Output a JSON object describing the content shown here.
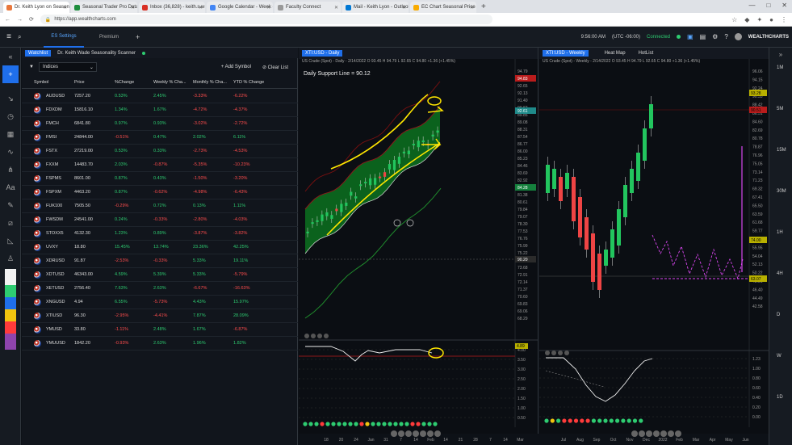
{
  "browser": {
    "tabs": [
      {
        "label": "Dr. Keith Lyon on Seasonal - Wea",
        "color": "#e8773d",
        "active": true
      },
      {
        "label": "Seasonal Trader Pro Database",
        "color": "#1e8e3e"
      },
      {
        "label": "Inbox (36,828) - keith.s.w@ib...",
        "color": "#d93025"
      },
      {
        "label": "Google Calendar - Week of 14...",
        "color": "#4285f4"
      },
      {
        "label": "Faculty Connect",
        "color": "#999999"
      },
      {
        "label": "Mail - Keith Lyon - Outlook",
        "color": "#0078d4"
      },
      {
        "label": "EC Chart Seasonal Price Tools",
        "color": "#f9ab00"
      }
    ],
    "url": "https://app.wealthcharts.com",
    "window_controls": [
      "—",
      "□",
      "✕"
    ]
  },
  "app": {
    "tabs": [
      "ES Settings",
      "Premium"
    ],
    "time": "9:56:00 AM",
    "tz": "(UTC -06:00)",
    "status": "Connected",
    "brand": "WEALTHCHARTS"
  },
  "watchlist": {
    "title": "Watchlist",
    "scanner": "Dr. Keith Wade Seasonality Scanner",
    "filter": "Indices",
    "add_label": "Add Symbol",
    "clear_label": "Clear List",
    "columns": [
      "Symbol",
      "Price",
      "%Change",
      "Weekly % Cha...",
      "Monthly % Cha...",
      "YTD % Change"
    ],
    "rows": [
      {
        "s": "AUDUSD",
        "p": "7257.20",
        "c": "0.53%",
        "w": "2.45%",
        "m": "-3.33%",
        "y": "-6.22%"
      },
      {
        "s": "FDXDM",
        "p": "15816.10",
        "c": "1.34%",
        "w": "1.67%",
        "m": "-4.72%",
        "y": "-4.37%"
      },
      {
        "s": "FMCH",
        "p": "6841.80",
        "c": "0.97%",
        "w": "0.93%",
        "m": "-3.02%",
        "y": "-2.72%"
      },
      {
        "s": "FMSI",
        "p": "24844.00",
        "c": "-0.51%",
        "w": "0.47%",
        "m": "2.02%",
        "y": "6.11%"
      },
      {
        "s": "FSTX",
        "p": "27219.00",
        "c": "0.53%",
        "w": "0.33%",
        "m": "-2.73%",
        "y": "-4.53%"
      },
      {
        "s": "FXXM",
        "p": "14483.70",
        "c": "2.03%",
        "w": "-0.87%",
        "m": "-5.35%",
        "y": "-10.23%"
      },
      {
        "s": "FSPMS",
        "p": "8601.00",
        "c": "0.87%",
        "w": "0.43%",
        "m": "-1.50%",
        "y": "-3.20%"
      },
      {
        "s": "FSPXM",
        "p": "4463.20",
        "c": "0.87%",
        "w": "-0.62%",
        "m": "-4.98%",
        "y": "-6.43%"
      },
      {
        "s": "FUK100",
        "p": "7505.50",
        "c": "-0.29%",
        "w": "0.72%",
        "m": "0.13%",
        "y": "1.11%"
      },
      {
        "s": "FWSDM",
        "p": "24541.00",
        "c": "0.24%",
        "w": "-0.33%",
        "m": "-2.80%",
        "y": "-4.03%"
      },
      {
        "s": "STOXX5",
        "p": "4132.30",
        "c": "1.23%",
        "w": "0.89%",
        "m": "-3.87%",
        "y": "-3.82%"
      },
      {
        "s": "UVXY",
        "p": "18.80",
        "c": "15.45%",
        "w": "13.74%",
        "m": "23.36%",
        "y": "42.25%"
      },
      {
        "s": "XDRUSD",
        "p": "91.87",
        "c": "-2.53%",
        "w": "-0.33%",
        "m": "5.33%",
        "y": "19.11%"
      },
      {
        "s": "XDTUSD",
        "p": "46343.00",
        "c": "4.59%",
        "w": "5.39%",
        "m": "5.33%",
        "y": "-5.79%"
      },
      {
        "s": "XETUSD",
        "p": "2756.40",
        "c": "7.63%",
        "w": "2.63%",
        "m": "-6.67%",
        "y": "-16.63%"
      },
      {
        "s": "XNGUSD",
        "p": "4.94",
        "c": "6.55%",
        "w": "-5.73%",
        "m": "4.43%",
        "y": "15.97%"
      },
      {
        "s": "XTIUSD",
        "p": "96.30",
        "c": "-2.95%",
        "w": "-4.41%",
        "m": "7.87%",
        "y": "28.09%"
      },
      {
        "s": "YMUSD",
        "p": "33.80",
        "c": "-1.11%",
        "w": "2.48%",
        "m": "1.67%",
        "y": "-6.87%"
      },
      {
        "s": "YMUUSD",
        "p": "1842.20",
        "c": "-0.93%",
        "w": "2.63%",
        "m": "1.96%",
        "y": "1.82%"
      }
    ]
  },
  "chart1": {
    "symbol": "XTI:USD - Daily",
    "info": "US Crude (Spot) - Daily - 2/14/2022 O 93.45 H 94.79 L 92.65 C 94.80 +1.36 (+1.45%)",
    "annotation": "Daily Support Line = 90.12",
    "price_labels": [
      "94.79",
      "93.40",
      "92.65",
      "92.13",
      "91.40",
      "90.62",
      "89.85",
      "89.08",
      "88.31",
      "87.54",
      "86.77",
      "86.00",
      "85.23",
      "84.46",
      "83.69",
      "82.92",
      "82.15",
      "81.38",
      "80.61",
      "79.84",
      "79.07",
      "78.30",
      "77.53",
      "76.76",
      "75.99",
      "75.22",
      "74.45",
      "73.68",
      "72.91",
      "72.14",
      "71.37",
      "70.60",
      "69.83",
      "69.06",
      "68.29"
    ],
    "tags": [
      {
        "text": "94.83",
        "color": "#b91c1c"
      },
      {
        "text": "92.61",
        "color": "#1f8a8a"
      },
      {
        "text": "90.20",
        "color": "#2b2b2b"
      },
      {
        "text": "84.28",
        "color": "#15803d"
      },
      {
        "text": "77.44",
        "color": "#333"
      }
    ],
    "dates": [
      "18",
      "20",
      "24",
      "Jan",
      "31",
      "7",
      "14",
      "Feb",
      "14",
      "21",
      "28",
      "7",
      "14",
      "Mar"
    ],
    "ind_labels": [
      "4.00",
      "3.50",
      "3.00",
      "2.50",
      "2.00",
      "1.50",
      "1.00",
      "0.50"
    ],
    "ind_tag": "4.89",
    "dots": [
      "#2ecc71",
      "#2ecc71",
      "#2ecc71",
      "#ff3b3b",
      "#2ecc71",
      "#2ecc71",
      "#2ecc71",
      "#2ecc71",
      "#2ecc71",
      "#2ecc71",
      "#ff3b3b",
      "#f1c40f",
      "#2ecc71",
      "#2ecc71",
      "#2ecc71",
      "#2ecc71",
      "#2ecc71",
      "#2ecc71",
      "#2ecc71",
      "#ff3b3b",
      "#ff3b3b",
      "#2ecc71",
      "#2ecc71",
      "#2ecc71"
    ]
  },
  "chart2": {
    "symbol": "XTI:USD - Weekly",
    "t2": "Heat Map",
    "t3": "HotList",
    "info": "US Crude (Spot) - Weekly - 2/14/2022 O 93.45 H 94.79 L 92.65 C 94.80 +1.36 (+1.45%)",
    "price_labels": [
      "96.06",
      "94.15",
      "92.24",
      "90.33",
      "88.42",
      "86.51",
      "84.60",
      "82.69",
      "80.78",
      "78.87",
      "76.96",
      "75.05",
      "73.14",
      "71.23",
      "69.32",
      "67.41",
      "65.50",
      "63.59",
      "61.68",
      "59.77",
      "57.86",
      "55.95",
      "54.04",
      "52.13",
      "50.22",
      "48.31",
      "46.40",
      "44.49",
      "42.58"
    ],
    "tags": [
      {
        "text": "93.28",
        "color": "#b8b000"
      },
      {
        "text": "90.51",
        "color": "#b91c1c"
      },
      {
        "text": "74.00",
        "color": "#b8b000"
      },
      {
        "text": "63.07",
        "color": "#b8b000"
      }
    ],
    "dates": [
      "Jul",
      "Aug",
      "Sep",
      "Oct",
      "Nov",
      "Dec",
      "2022",
      "Feb",
      "Mar",
      "Apr",
      "May",
      "Jun"
    ],
    "ind_labels": [
      "1.23",
      "1.00",
      "0.80",
      "0.60",
      "0.40",
      "0.20",
      "0.00"
    ],
    "dots": [
      "#2ecc71",
      "#f1c40f",
      "#2ecc71",
      "#ff3b3b",
      "#ff3b3b",
      "#ff3b3b",
      "#ff3b3b",
      "#ff3b3b",
      "#2ecc71",
      "#2ecc71",
      "#2ecc71",
      "#2ecc71",
      "#2ecc71",
      "#2ecc71",
      "#2ecc71",
      "#2ecc71",
      "#2ecc71"
    ]
  },
  "timeframes": [
    "1M",
    "5M",
    "15M",
    "30M",
    "1H",
    "4H",
    "D",
    "W",
    "1D"
  ]
}
